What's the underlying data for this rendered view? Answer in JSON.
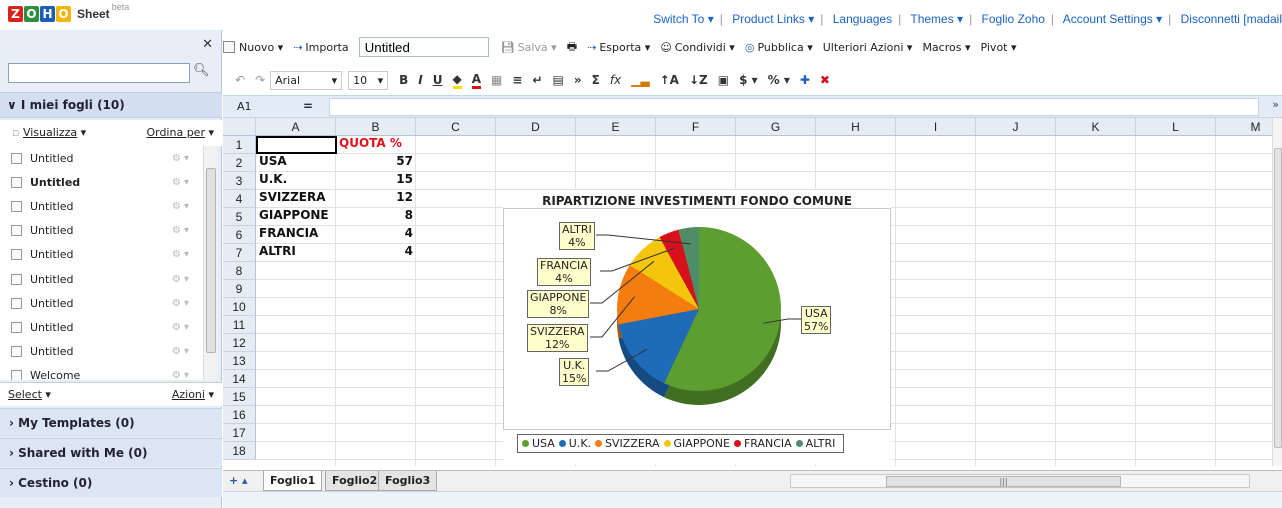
{
  "app": {
    "logo_letters": [
      "Z",
      "O",
      "H",
      "O"
    ],
    "logo_colors": [
      "#d9241c",
      "#2f8f3d",
      "#1d5fb4",
      "#f2b706"
    ],
    "name": "Sheet",
    "beta": "beta"
  },
  "top_links": [
    "Switch To ▾",
    "Product Links ▾",
    "Languages",
    "Themes ▾",
    "Foglio Zoho",
    "Account Settings ▾",
    "Disconnetti [madail"
  ],
  "left_panel": {
    "close": "✕",
    "search_placeholder": "",
    "my_sheets_header": "I miei fogli (10)",
    "visualizza": "Visualizza",
    "ordina_per": "Ordina per",
    "items": [
      {
        "label": "Untitled",
        "bold": false
      },
      {
        "label": "Untitled",
        "bold": true
      },
      {
        "label": "Untitled",
        "bold": false
      },
      {
        "label": "Untitled",
        "bold": false
      },
      {
        "label": "Untitled",
        "bold": false
      },
      {
        "label": "Untitled",
        "bold": false
      },
      {
        "label": "Untitled",
        "bold": false
      },
      {
        "label": "Untitled",
        "bold": false
      },
      {
        "label": "Untitled",
        "bold": false
      },
      {
        "label": "Welcome",
        "bold": false
      }
    ],
    "select": "Select",
    "azioni": "Azioni",
    "sections": [
      "My Templates (0)",
      "Shared with Me (0)",
      "Cestino (0)"
    ]
  },
  "toolbar1": {
    "nuovo": "Nuovo ▾",
    "importa": "Importa",
    "title_value": "Untitled",
    "salva": "Salva ▾",
    "esporta": "Esporta ▾",
    "condividi": "Condividi ▾",
    "pubblica": "Pubblica ▾",
    "ulteriori": "Ulteriori Azioni ▾",
    "macros": "Macros ▾",
    "pivot": "Pivot ▾"
  },
  "toolbar2": {
    "font": "Arial",
    "size": "10",
    "bold": "B",
    "italic": "I",
    "underline": "U",
    "sum": "Σ",
    "fx": "fx",
    "currency": "$ ▾",
    "percent": "% ▾"
  },
  "formula_bar": {
    "cell_ref": "A1",
    "equals": "=",
    "value": ""
  },
  "grid": {
    "columns": [
      "A",
      "B",
      "C",
      "D",
      "E",
      "F",
      "G",
      "H",
      "I",
      "J",
      "K",
      "L",
      "M"
    ],
    "rows": [
      "1",
      "2",
      "3",
      "4",
      "5",
      "6",
      "7",
      "8",
      "9",
      "10",
      "11",
      "12",
      "13",
      "14",
      "15",
      "16",
      "17",
      "18"
    ],
    "header_b1": "QUOTA %",
    "data": [
      {
        "country": "USA",
        "quota": "57"
      },
      {
        "country": "U.K.",
        "quota": "15"
      },
      {
        "country": "SVIZZERA",
        "quota": "12"
      },
      {
        "country": "GIAPPONE",
        "quota": "8"
      },
      {
        "country": "FRANCIA",
        "quota": "4"
      },
      {
        "country": "ALTRI",
        "quota": "4"
      }
    ]
  },
  "chart_data": {
    "type": "pie",
    "title": "RIPARTIZIONE INVESTIMENTI FONDO COMUNE",
    "categories": [
      "USA",
      "U.K.",
      "SVIZZERA",
      "GIAPPONE",
      "FRANCIA",
      "ALTRI"
    ],
    "values": [
      57,
      15,
      12,
      8,
      4,
      4
    ],
    "labels": [
      "USA\n57%",
      "U.K.\n15%",
      "SVIZZERA\n12%",
      "GIAPPONE\n8%",
      "FRANCIA\n4%",
      "ALTRI\n4%"
    ],
    "colors": [
      "#5c9e2f",
      "#1e6bb8",
      "#f57d10",
      "#f4c50d",
      "#d8101c",
      "#4f8c68"
    ],
    "legend_position": "bottom"
  },
  "sheet_tabs": [
    "Foglio1",
    "Foglio2",
    "Foglio3"
  ],
  "tab_controls": "+ ▴"
}
